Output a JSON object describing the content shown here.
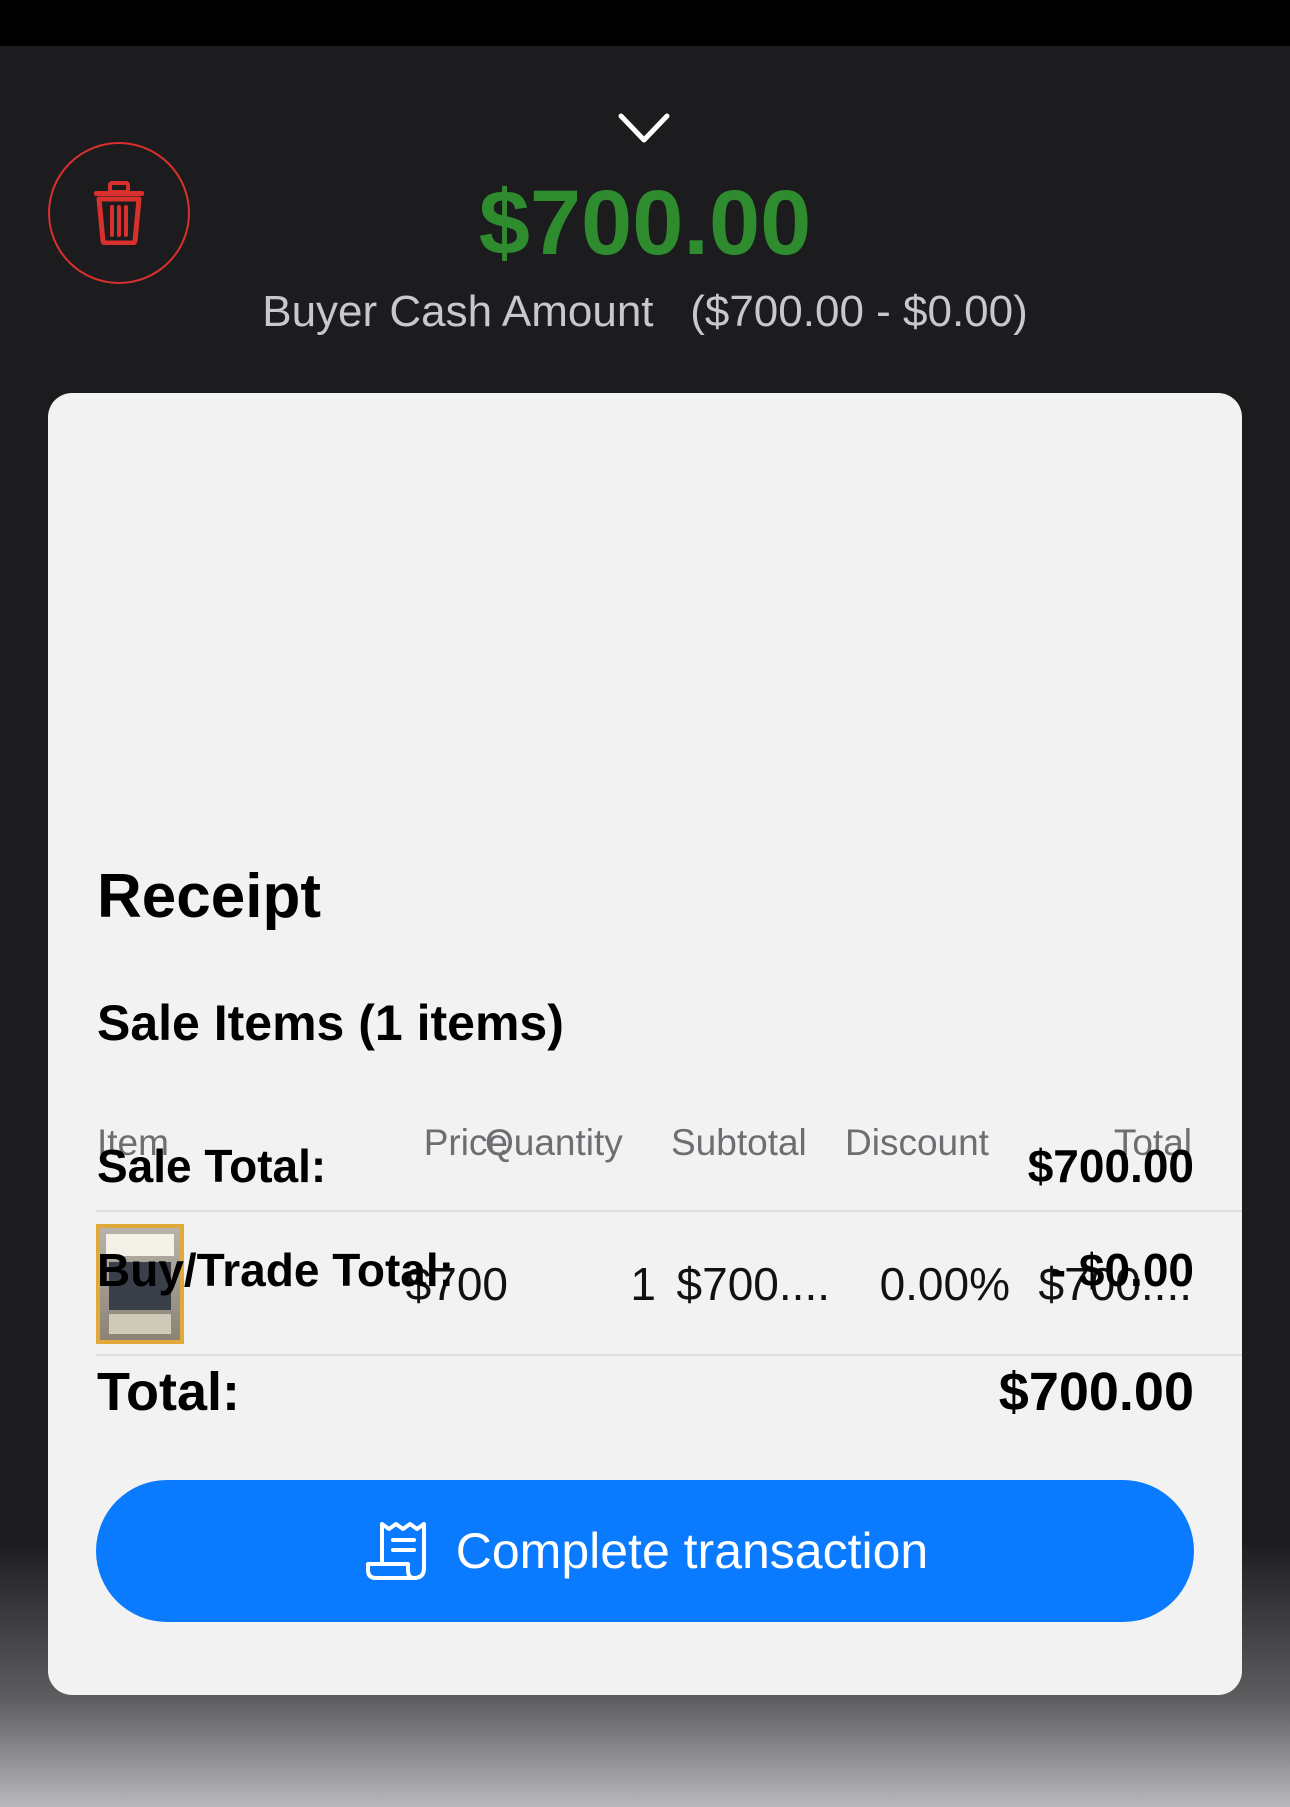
{
  "header": {
    "amount": "$700.00",
    "caption": "Buyer Cash Amount   ($700.00 - $0.00)",
    "amount_color": "#2e8b2e",
    "icons": {
      "collapse": "chevron-down-icon",
      "delete": "trash-icon"
    }
  },
  "receipt": {
    "title": "Receipt",
    "sale_items_heading": "Sale Items (1 items)",
    "columns": [
      "Item",
      "Price",
      "Quantity",
      "Subtotal",
      "Discount",
      "Total"
    ],
    "rows": [
      {
        "thumbnail": "trading-card-thumbnail",
        "price": "$700",
        "quantity": "1",
        "subtotal": "$700....",
        "discount": "0.00%",
        "total": "$700...."
      }
    ],
    "summary": {
      "sale_total_label": "Sale Total:",
      "sale_total_value": "$700.00",
      "buy_trade_total_label": "Buy/Trade Total:",
      "buy_trade_total_value": "- $0.00",
      "total_label": "Total:",
      "total_value": "$700.00"
    },
    "complete_button": {
      "label": "Complete transaction",
      "icon": "receipt-icon",
      "color": "#0a7aff"
    }
  }
}
